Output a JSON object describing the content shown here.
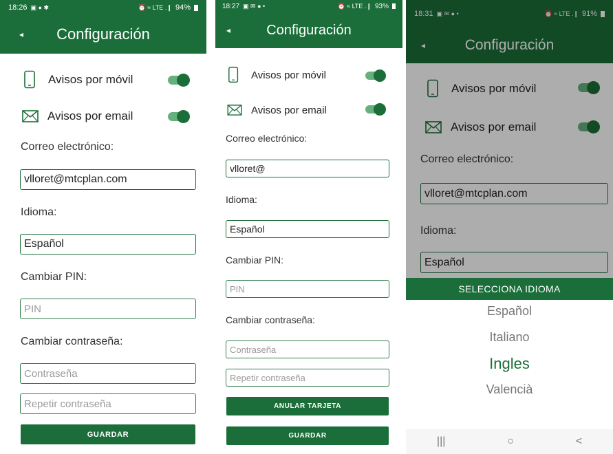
{
  "colors": {
    "primary": "#1b6e39",
    "toggle_track": "#66b07d",
    "placeholder": "#9a9a9a"
  },
  "screens": [
    {
      "status": {
        "time": "18:26",
        "left_icons": "▣ ● ✱",
        "right_icons": "⏰ ≈ LTE .❙",
        "battery": "94%"
      },
      "appbar": {
        "title": "Configuración",
        "back_icon": "◂"
      },
      "notify_mobile": {
        "label": "Avisos por móvil",
        "icon": "phone-icon",
        "on": true
      },
      "notify_email": {
        "label": "Avisos por email",
        "icon": "envelope-icon",
        "on": true
      },
      "email": {
        "label": "Correo electrónico:",
        "value": "vlloret@mtcplan.com"
      },
      "language": {
        "label": "Idioma:",
        "value": "Español"
      },
      "pin": {
        "label": "Cambiar PIN:",
        "placeholder": "PIN"
      },
      "password": {
        "label": "Cambiar contraseña:",
        "placeholder": "Contraseña",
        "repeat_placeholder": "Repetir contraseña"
      },
      "save_button": "GUARDAR"
    },
    {
      "status": {
        "time": "18:27",
        "left_icons": "▣ ✉ ● •",
        "right_icons": "⏰ ≈ LTE .❙",
        "battery": "93%"
      },
      "appbar": {
        "title": "Configuración",
        "back_icon": "◂"
      },
      "notify_mobile": {
        "label": "Avisos por móvil",
        "icon": "phone-icon",
        "on": true
      },
      "notify_email": {
        "label": "Avisos por email",
        "icon": "envelope-icon",
        "on": true
      },
      "email": {
        "label": "Correo electrónico:",
        "value": "vlloret@"
      },
      "language": {
        "label": "Idioma:",
        "value": "Español"
      },
      "pin": {
        "label": "Cambiar PIN:",
        "placeholder": "PIN"
      },
      "password": {
        "label": "Cambiar contraseña:",
        "placeholder": "Contraseña",
        "repeat_placeholder": "Repetir contraseña"
      },
      "cancel_card_button": "ANULAR TARJETA",
      "save_button": "GUARDAR"
    },
    {
      "status": {
        "time": "18:31",
        "left_icons": "▣ ✉ ● •",
        "right_icons": "⏰ ≈ LTE .❙",
        "battery": "91%"
      },
      "appbar": {
        "title": "Configuración",
        "back_icon": "◂"
      },
      "notify_mobile": {
        "label": "Avisos por móvil",
        "icon": "phone-icon",
        "on": true
      },
      "notify_email": {
        "label": "Avisos por email",
        "icon": "envelope-icon",
        "on": true
      },
      "email": {
        "label": "Correo electrónico:",
        "value": "vlloret@mtcplan.com"
      },
      "language": {
        "label": "Idioma:",
        "value": "Español"
      },
      "picker": {
        "title": "SELECCIONA IDIOMA",
        "options": [
          "Español",
          "Italiano",
          "Ingles",
          "Valencià"
        ],
        "selected": "Ingles"
      },
      "navbar": {
        "recent": "|||",
        "home": "○",
        "back": "<"
      }
    }
  ]
}
